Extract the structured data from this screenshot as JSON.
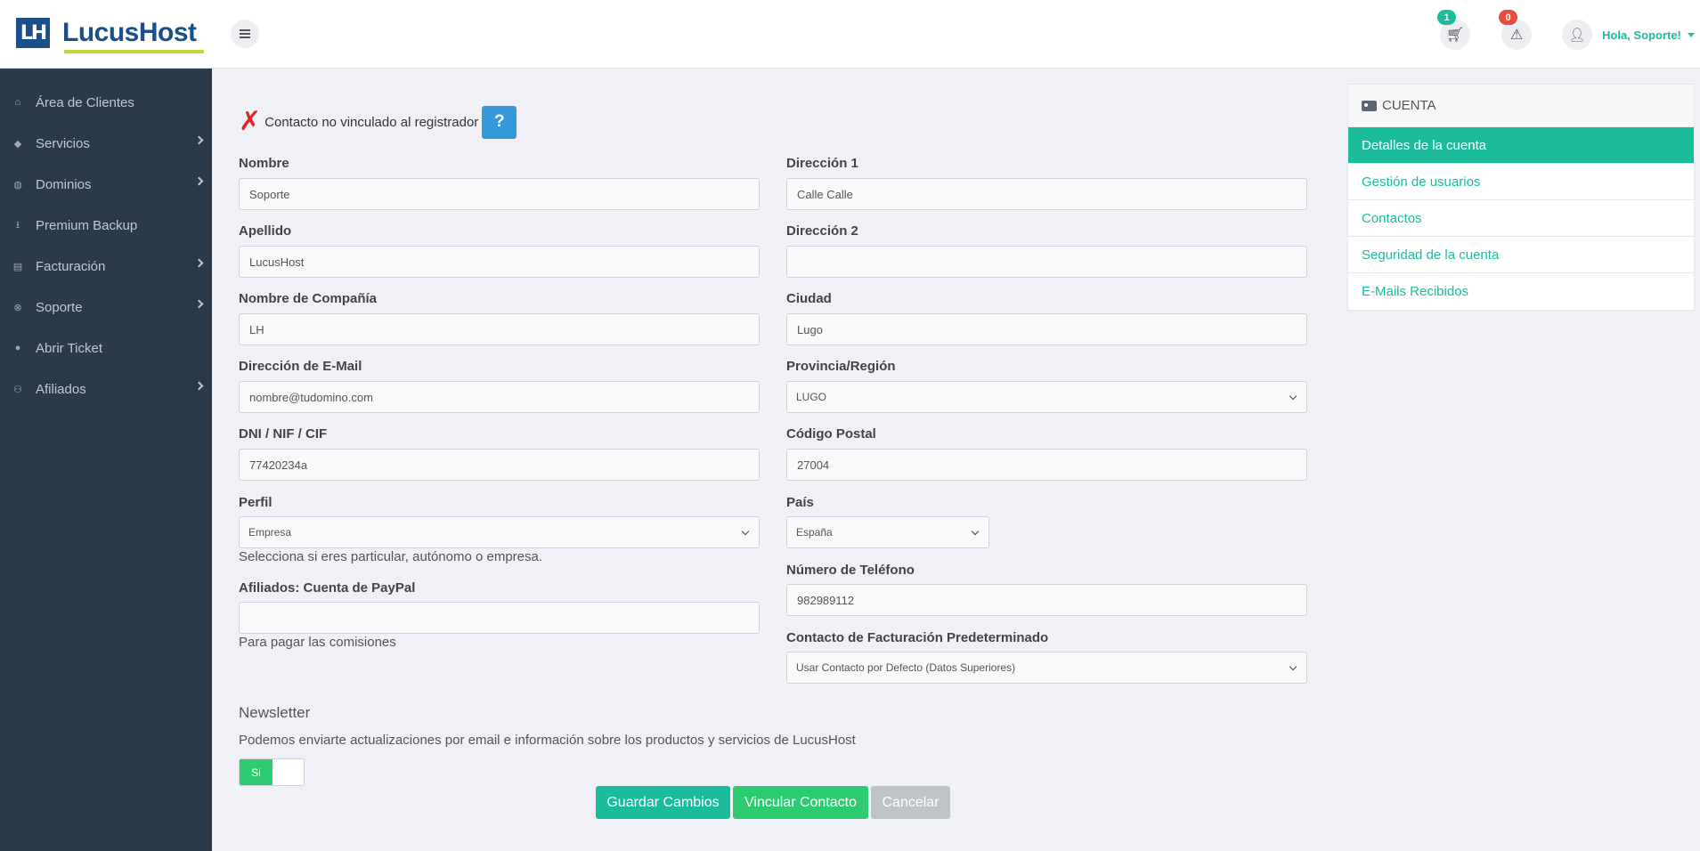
{
  "brand": {
    "mark": "LH",
    "name": "LucusHost",
    "accent": "#1abc9c",
    "logo_blue": "#1a4f8a"
  },
  "header": {
    "cart_count": "1",
    "alerts_count": "0",
    "greeting": "Hola, Soporte!"
  },
  "sidebar": {
    "items": [
      {
        "label": "Área de Clientes",
        "icon": "home-icon",
        "glyph": "⌂",
        "has_children": false
      },
      {
        "label": "Servicios",
        "icon": "cube-icon",
        "glyph": "◆",
        "has_children": true
      },
      {
        "label": "Dominios",
        "icon": "globe-icon",
        "glyph": "◍",
        "has_children": true
      },
      {
        "label": "Premium Backup",
        "icon": "download-icon",
        "glyph": "⭳",
        "has_children": false
      },
      {
        "label": "Facturación",
        "icon": "invoice-icon",
        "glyph": "▤",
        "has_children": true
      },
      {
        "label": "Soporte",
        "icon": "lifebuoy-icon",
        "glyph": "⊗",
        "has_children": true
      },
      {
        "label": "Abrir Ticket",
        "icon": "comment-icon",
        "glyph": "●",
        "has_children": false
      },
      {
        "label": "Afiliados",
        "icon": "users-icon",
        "glyph": "⚇",
        "has_children": true
      }
    ]
  },
  "status": {
    "mark": "✗",
    "text": "Contacto no vinculado al registrador",
    "help": "?"
  },
  "form": {
    "first_name": {
      "label": "Nombre",
      "value": "Soporte"
    },
    "last_name": {
      "label": "Apellido",
      "value": "LucusHost"
    },
    "company": {
      "label": "Nombre de Compañía",
      "value": "LH"
    },
    "email": {
      "label": "Dirección de E-Mail",
      "value": "nombre@tudomino.com"
    },
    "tax_id": {
      "label": "DNI / NIF / CIF",
      "value": "77420234a"
    },
    "profile": {
      "label": "Perfil",
      "value": "Empresa",
      "help": "Selecciona si eres particular, autónomo o empresa."
    },
    "paypal": {
      "label": "Afiliados: Cuenta de PayPal",
      "value": "",
      "help": "Para pagar las comisiones"
    },
    "address1": {
      "label": "Dirección 1",
      "value": "Calle Calle"
    },
    "address2": {
      "label": "Dirección 2",
      "value": ""
    },
    "city": {
      "label": "Ciudad",
      "value": "Lugo"
    },
    "state": {
      "label": "Provincia/Región",
      "value": "LUGO"
    },
    "postcode": {
      "label": "Código Postal",
      "value": "27004"
    },
    "country": {
      "label": "País",
      "value": "España"
    },
    "phone": {
      "label": "Número de Teléfono",
      "value": "982989112"
    },
    "billing_contact": {
      "label": "Contacto de Facturación Predeterminado",
      "value": "Usar Contacto por Defecto (Datos Superiores)"
    }
  },
  "newsletter": {
    "title": "Newsletter",
    "description": "Podemos enviarte actualizaciones por email e información sobre los productos y servicios de LucusHost",
    "toggle_label": "Si"
  },
  "actions": {
    "save": "Guardar Cambios",
    "link": "Vincular Contacto",
    "cancel": "Cancelar"
  },
  "account_panel": {
    "title": "CUENTA",
    "items": [
      "Detalles de la cuenta",
      "Gestión de usuarios",
      "Contactos",
      "Seguridad de la cuenta",
      "E-Mails Recibidos"
    ]
  }
}
